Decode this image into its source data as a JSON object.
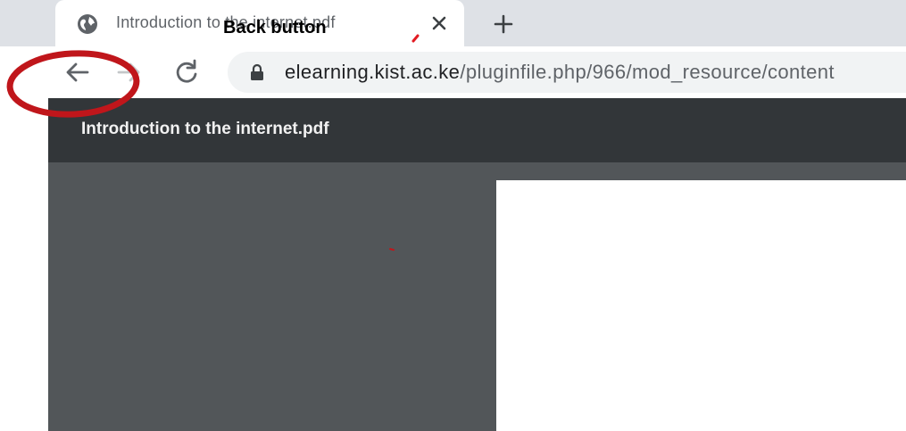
{
  "tab": {
    "title": "Introduction to the internet.pdf",
    "favicon": "globe-icon",
    "close_icon": "close-icon"
  },
  "new_tab_icon": "plus-icon",
  "toolbar": {
    "back_icon": "arrow-left-icon",
    "forward_icon": "arrow-right-icon",
    "reload_icon": "reload-icon",
    "lock_icon": "lock-icon"
  },
  "address_bar": {
    "domain": "elearning.kist.ac.ke",
    "path": "/pluginfile.php/966/mod_resource/content"
  },
  "pdf_viewer": {
    "title": "Introduction to the internet.pdf"
  },
  "annotation": {
    "label": "Back button",
    "circle_color": "#c0161b"
  },
  "colors": {
    "tab_strip": "#dee1e6",
    "viewer_toolbar": "#323639",
    "viewer_background": "#525659",
    "page": "#ffffff"
  }
}
